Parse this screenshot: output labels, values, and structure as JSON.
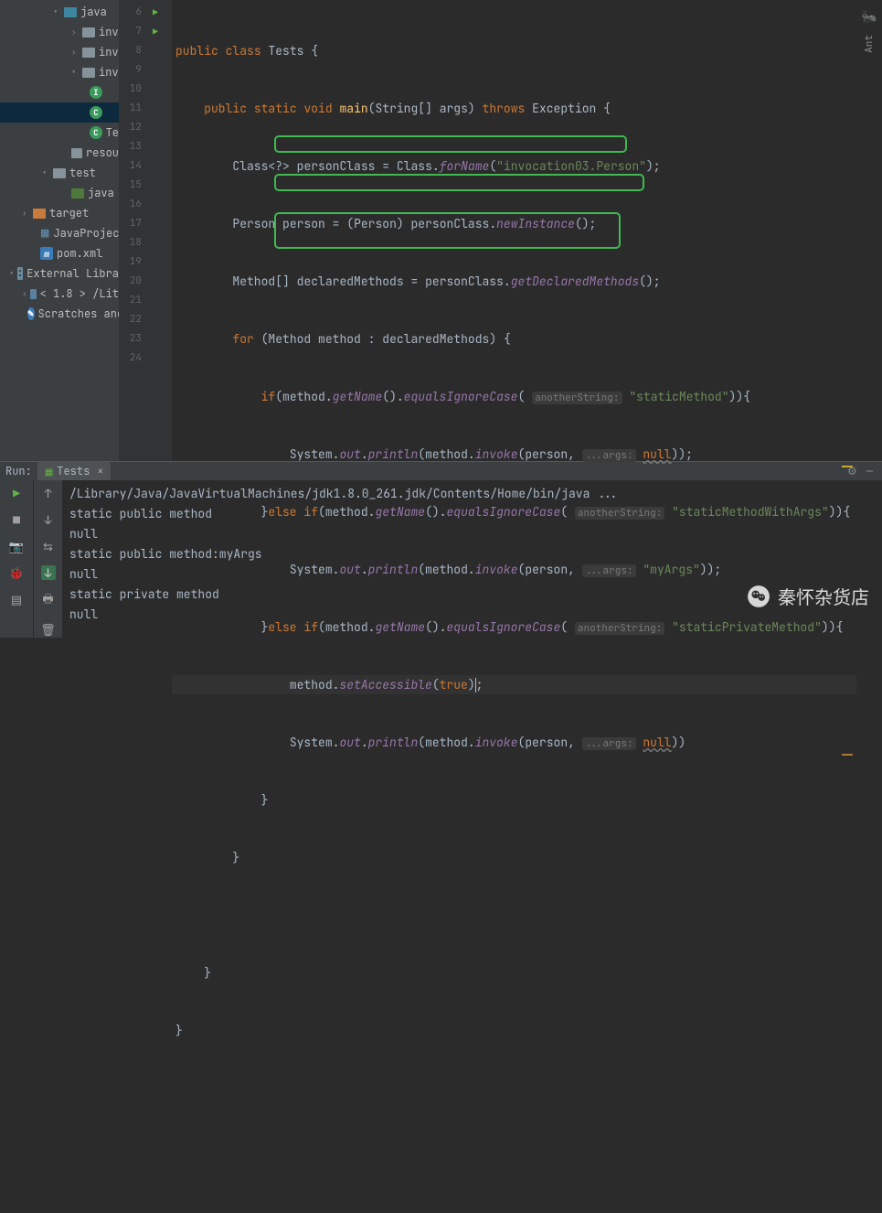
{
  "sidebar": {
    "items": [
      {
        "label": "java"
      },
      {
        "label": "inv"
      },
      {
        "label": "inv"
      },
      {
        "label": "inv"
      },
      {
        "label": ""
      },
      {
        "label": ""
      },
      {
        "label": "Te"
      },
      {
        "label": "resou"
      },
      {
        "label": "test"
      },
      {
        "label": "java"
      },
      {
        "label": "target"
      },
      {
        "label": "JavaProjec"
      },
      {
        "label": "pom.xml"
      },
      {
        "label": "External Libra"
      },
      {
        "label": "< 1.8 > /Lit"
      },
      {
        "label": "Scratches and"
      }
    ]
  },
  "gutter": {
    "line_start": 6,
    "line_end": 24
  },
  "code": {
    "l6": {
      "public": "public",
      "class": "class",
      "name": "Tests"
    },
    "l7": {
      "public": "public",
      "static": "static",
      "void": "void",
      "main": "main",
      "string": "String",
      "args": "args",
      "throws": "throws",
      "exc": "Exception"
    },
    "l8": {
      "cls": "Class",
      "w": "<?>",
      "var": "personClass",
      "eq": "=",
      "cl": "Class",
      "fn": "forName",
      "arg": "\"invocation03.Person\""
    },
    "l9": {
      "cls": "Person",
      "var": "person",
      "eq": "=",
      "cast": "(Person)",
      "pc": "personClass",
      "fn": "newInstance"
    },
    "l10": {
      "cls": "Method",
      "arr": "[]",
      "var": "declaredMethods",
      "eq": "=",
      "pc": "personClass",
      "fn": "getDeclaredMethods"
    },
    "l11": {
      "for": "for",
      "cls": "Method",
      "it": "method",
      "col": ":",
      "arr": "declaredMethods"
    },
    "l12": {
      "if": "if",
      "m": "method",
      "gn": "getName",
      "eic": "equalsIgnoreCase",
      "hint": "anotherString:",
      "str": "\"staticMethod\""
    },
    "l13": {
      "sys": "System",
      "out": "out",
      "pl": "println",
      "m": "method",
      "inv": "invoke",
      "p": "person",
      "hint": "...args:",
      "nul": "null"
    },
    "l14": {
      "else": "else if",
      "m": "method",
      "gn": "getName",
      "eic": "equalsIgnoreCase",
      "hint": "anotherString:",
      "str": "\"staticMethodWithArgs\""
    },
    "l15": {
      "sys": "System",
      "out": "out",
      "pl": "println",
      "m": "method",
      "inv": "invoke",
      "p": "person",
      "hint": "...args:",
      "str": "\"myArgs\""
    },
    "l16": {
      "else": "else if",
      "m": "method",
      "gn": "getName",
      "eic": "equalsIgnoreCase",
      "hint": "anotherString:",
      "str": "\"staticPrivateMethod\""
    },
    "l17": {
      "m": "method",
      "sa": "setAccessible",
      "true": "true"
    },
    "l18": {
      "sys": "System",
      "out": "out",
      "pl": "println",
      "m": "method",
      "inv": "invoke",
      "p": "person",
      "hint": "...args:",
      "nul": "null"
    }
  },
  "run": {
    "label": "Run:",
    "tab": "Tests",
    "lines": [
      "/Library/Java/JavaVirtualMachines/jdk1.8.0_261.jdk/Contents/Home/bin/java ...",
      "static public method",
      "null",
      "static public method:myArgs",
      "null",
      "static private method",
      "null"
    ]
  },
  "rightRail": {
    "ant": "Ant"
  },
  "watermark": "秦怀杂货店"
}
